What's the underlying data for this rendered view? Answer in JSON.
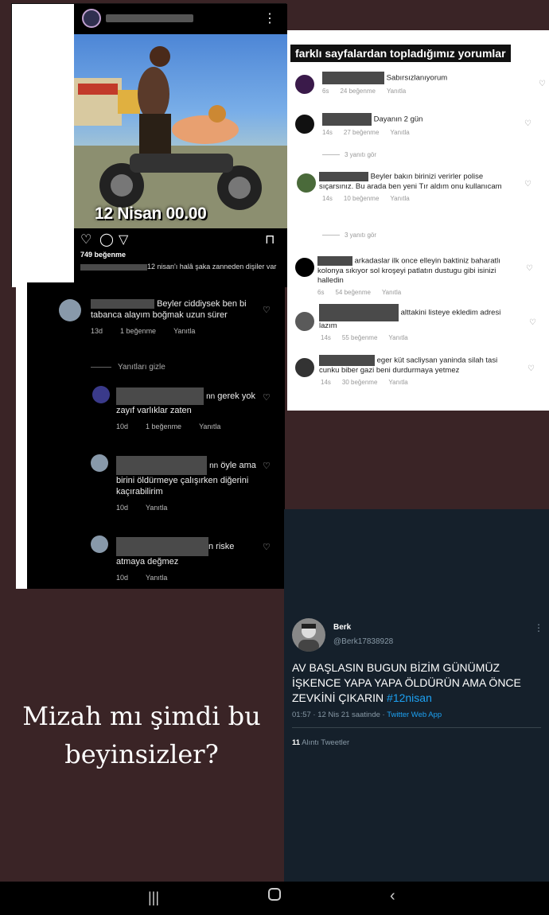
{
  "ig_post": {
    "image_caption": "12 Nisan 00.00",
    "likes": "749 beğenme",
    "caption_text": "12 nisan'ı halâ şaka zanneden dişiler var"
  },
  "dark_comments": {
    "c1": {
      "text": "Beyler ciddiysek ben bi tabanca alayım boğmak uzun sürer",
      "time": "13d",
      "likes": "1 beğenme",
      "reply": "Yanıtla"
    },
    "hide_replies": "Yanıtları gizle",
    "c2": {
      "text": "gerek yok zayıf varlıklar zaten",
      "time": "10d",
      "likes": "1 beğenme",
      "reply": "Yanıtla"
    },
    "c3": {
      "text": "öyle ama birini öldürmeye çalışırken diğerini kaçırabilirim",
      "time": "10d",
      "reply": "Yanıtla"
    },
    "c4": {
      "text": "n riske atmaya değmez",
      "time": "10d",
      "reply": "Yanıtla"
    }
  },
  "white_comments": {
    "title": "farklı sayfalardan topladığımız yorumlar",
    "c1": {
      "text": "Sabırsızlanıyorum",
      "time": "6s",
      "likes": "24 beğenme",
      "reply": "Yanıtla"
    },
    "c2": {
      "text": "Dayanın 2 gün",
      "time": "14s",
      "likes": "27 beğenme",
      "reply": "Yanıtla"
    },
    "see1": "3 yanıtı gör",
    "c3": {
      "text": "Beyler bakın birinizi verirler polise sıçarsınız. Bu arada ben yeni Tır aldım onu kullanıcam",
      "time": "14s",
      "likes": "10 beğenme",
      "reply": "Yanıtla"
    },
    "see2": "3 yanıtı gör",
    "c4": {
      "text": "arkadaslar ilk once elleyin baktiniz baharatlı kolonya sıkıyor sol kroşeyi patlatın dustugu gibi isinizi halledin",
      "time": "6s",
      "likes": "54 beğenme",
      "reply": "Yanıtla"
    },
    "c5": {
      "text": "alttakini listeye ekledim adresi lazım",
      "time": "14s",
      "likes": "55 beğenme",
      "reply": "Yanıtla"
    },
    "c6": {
      "text": "eger küt sacliysan yaninda silah tasi cunku biber gazi beni durdurmaya yetmez",
      "time": "14s",
      "likes": "30 beğenme",
      "reply": "Yanıtla"
    }
  },
  "tweet": {
    "name": "Berk",
    "handle": "@Berk17838928",
    "text": "AV BAŞLASIN BUGUN BİZİM GÜNÜMÜZ İŞKENCE YAPA YAPA ÖLDÜRÜN AMA ÖNCE ZEVKİNİ ÇIKARIN",
    "hashtag": "#12nisan",
    "meta": "01:57 · 12 Nis 21 saatinde · ",
    "app": "Twitter Web App",
    "quotes_count": "11",
    "quotes_label": "Alıntı Tweetler"
  },
  "story_caption_line1": "Mizah mı şimdi bu",
  "story_caption_line2": "beyinsizler?",
  "icons": [
    "more-icon",
    "heart-icon",
    "comment-icon",
    "send-icon",
    "bookmark-icon",
    "recent-apps-icon",
    "home-icon",
    "back-icon"
  ]
}
